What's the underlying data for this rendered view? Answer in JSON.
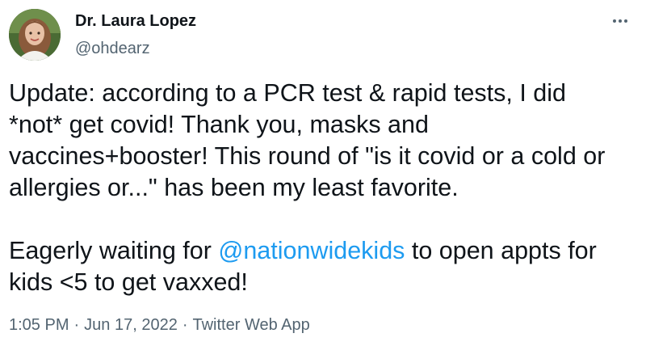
{
  "author": {
    "display_name": "Dr. Laura Lopez",
    "handle": "@ohdearz"
  },
  "tweet": {
    "lines": [
      "Update: according to a PCR test & rapid tests, I did",
      "*not* get covid! Thank you, masks and",
      "vaccines+booster! This round of \"is it covid or a cold or",
      "allergies or...\" has been my least favorite."
    ],
    "line5_prefix": "Eagerly waiting for ",
    "mention": "@nationwidekids",
    "line5_suffix": " to open appts for",
    "line6": "kids <5 to get vaxxed!"
  },
  "meta": {
    "time": "1:05 PM",
    "separator": "·",
    "date": "Jun 17, 2022",
    "source": "Twitter Web App"
  },
  "colors": {
    "text": "#0f1419",
    "secondary": "#536471",
    "link": "#1d9bf0"
  },
  "icons": {
    "more": "more-options-icon"
  }
}
